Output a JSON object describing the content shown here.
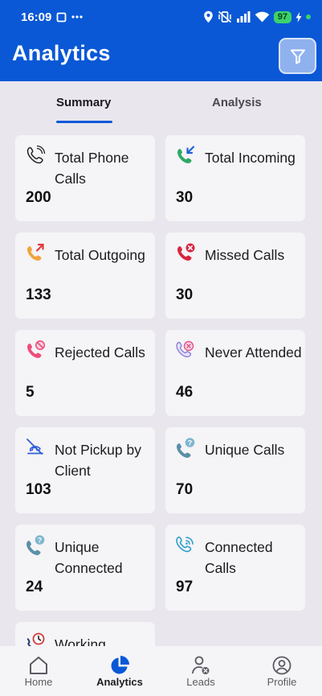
{
  "status_bar": {
    "time": "16:09",
    "battery": "97"
  },
  "app_bar": {
    "title": "Analytics",
    "filter_icon": "filter-icon"
  },
  "tabs": [
    {
      "label": "Summary",
      "active": true
    },
    {
      "label": "Analysis",
      "active": false
    }
  ],
  "cards": [
    {
      "title": "Total Phone Calls",
      "value": "200",
      "icon": "phone-ringing-icon"
    },
    {
      "title": "Total Incoming",
      "value": "30",
      "icon": "incoming-call-icon"
    },
    {
      "title": "Total Outgoing",
      "value": "133",
      "icon": "outgoing-call-icon"
    },
    {
      "title": "Missed Calls",
      "value": "30",
      "icon": "missed-call-icon"
    },
    {
      "title": "Rejected Calls",
      "value": "5",
      "icon": "rejected-call-icon"
    },
    {
      "title": "Never Attended",
      "value": "46",
      "icon": "never-attended-icon"
    },
    {
      "title": "Not Pickup by Client",
      "value": "103",
      "icon": "not-picked-up-icon"
    },
    {
      "title": "Unique Calls",
      "value": "70",
      "icon": "unique-calls-icon"
    },
    {
      "title": "Unique Connected",
      "value": "24",
      "icon": "unique-connected-icon"
    },
    {
      "title": "Connected Calls",
      "value": "97",
      "icon": "connected-calls-icon"
    },
    {
      "title": "Working",
      "value": "",
      "icon": "working-hours-icon"
    }
  ],
  "bottom_nav": [
    {
      "label": "Home",
      "icon": "home-icon",
      "active": false
    },
    {
      "label": "Analytics",
      "icon": "analytics-pie-icon",
      "active": true
    },
    {
      "label": "Leads",
      "icon": "leads-icon",
      "active": false
    },
    {
      "label": "Profile",
      "icon": "profile-icon",
      "active": false
    }
  ],
  "colors": {
    "primary": "#0a58d6",
    "background": "#e9e7ed",
    "card": "#f5f4f7"
  }
}
